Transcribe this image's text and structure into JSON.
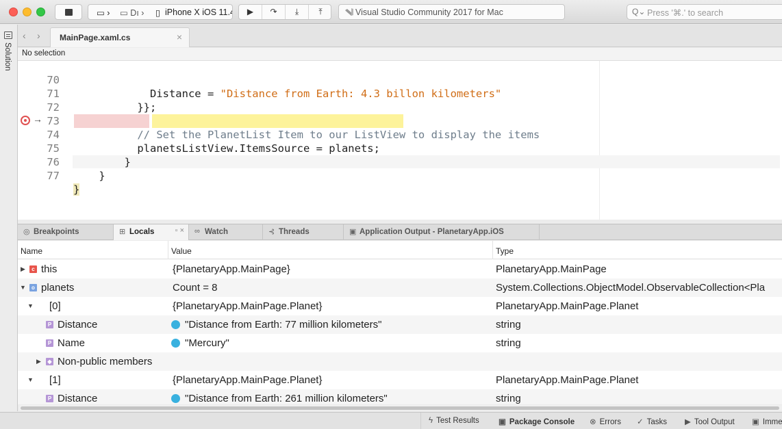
{
  "toolbar": {
    "target_device_short": "Dı",
    "target_device": "iPhone X iOS 11.4",
    "status_text": "Visual Studio Community 2017 for Mac",
    "search_placeholder": "Press '⌘.' to search"
  },
  "sidebar": {
    "label": "Solution"
  },
  "editor": {
    "tab_label": "MainPage.xaml.cs",
    "breadcrumb": "No selection",
    "lines": [
      {
        "num": "70",
        "text": "Distance = ",
        "string": "\"Distance from Earth: 4.3 billon kilometers\""
      },
      {
        "num": "71",
        "text": "}};"
      },
      {
        "num": "72",
        "text": ""
      },
      {
        "num": "73",
        "comment": "// Set the PlanetList Item to our ListView to display the items"
      },
      {
        "num": "74",
        "text": "planetsListView.ItemsSource = planets;"
      },
      {
        "num": "75",
        "text": "}"
      },
      {
        "num": "76",
        "text": "}"
      },
      {
        "num": "77",
        "text": "}"
      }
    ]
  },
  "pads": {
    "tabs": [
      "Breakpoints",
      "Locals",
      "Watch",
      "Threads",
      "Application Output - PlanetaryApp.iOS"
    ]
  },
  "locals": {
    "columns": [
      "Name",
      "Value",
      "Type"
    ],
    "rows": [
      {
        "name": "this",
        "value": "{PlanetaryApp.MainPage}",
        "type": "PlanetaryApp.MainPage"
      },
      {
        "name": "planets",
        "value": "Count = 8",
        "type": "System.Collections.ObjectModel.ObservableCollection<Pla"
      },
      {
        "name": "[0]",
        "value": "{PlanetaryApp.MainPage.Planet}",
        "type": "PlanetaryApp.MainPage.Planet"
      },
      {
        "name": "Distance",
        "value": "\"Distance from Earth: 77 million kilometers\"",
        "type": "string"
      },
      {
        "name": "Name",
        "value": "\"Mercury\"",
        "type": "string"
      },
      {
        "name": "Non-public members",
        "value": "",
        "type": ""
      },
      {
        "name": "[1]",
        "value": "{PlanetaryApp.MainPage.Planet}",
        "type": "PlanetaryApp.MainPage.Planet"
      },
      {
        "name": "Distance",
        "value": "\"Distance from Earth: 261 million kilometers\"",
        "type": "string"
      }
    ]
  },
  "statusbar": {
    "items": [
      "Test Results",
      "Package Console",
      "Errors",
      "Tasks",
      "Tool Output",
      "Imme"
    ]
  },
  "icons": {
    "toolbar": [
      "stop-icon",
      "device-icon",
      "play-icon",
      "step-over-icon",
      "step-into-icon",
      "step-out-icon",
      "visual-studio-icon",
      "search-icon"
    ],
    "statusbar": [
      "bolt-icon",
      "package-icon",
      "error-icon",
      "check-icon",
      "play-icon",
      "terminal-icon"
    ]
  }
}
